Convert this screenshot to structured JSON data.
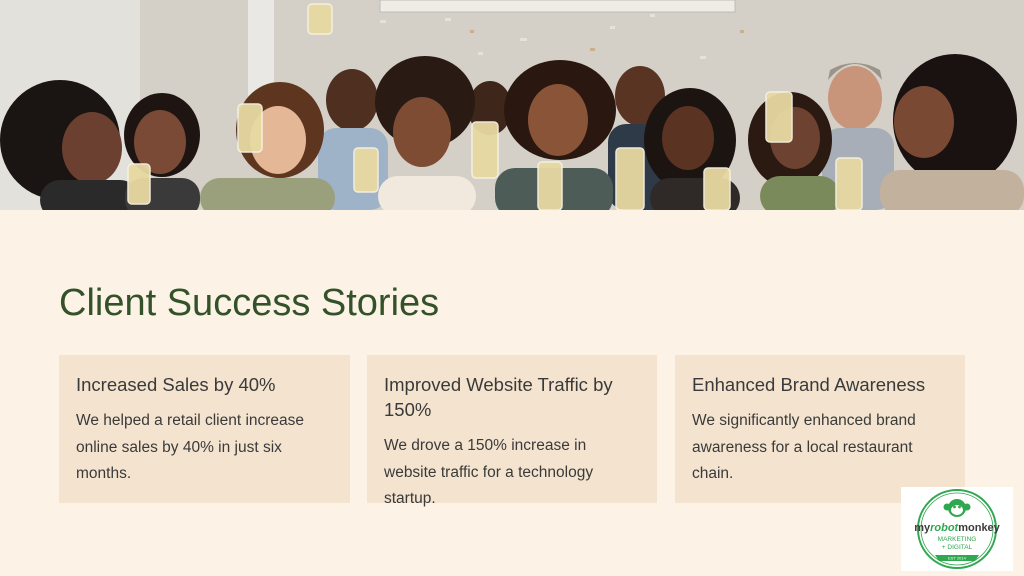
{
  "hero": {
    "image": "celebration-photo"
  },
  "title": "Client Success Stories",
  "cards": [
    {
      "heading": "Increased Sales by 40%",
      "body": "We helped a retail client increase online sales by 40% in just six months."
    },
    {
      "heading": "Improved Website Traffic by 150%",
      "body": "We drove a 150% increase in website traffic for a technology startup."
    },
    {
      "heading": "Enhanced Brand Awareness",
      "body": "We significantly enhanced brand awareness for a local restaurant chain."
    }
  ],
  "logo": {
    "wordmark_pre": "my",
    "wordmark_mid": "robot",
    "wordmark_post": "monkey",
    "line2": "MARKETING",
    "line3": "+ DIGITAL",
    "est": "EST 2014",
    "colors": {
      "green": "#2fa84f",
      "dark": "#3b3b3b"
    }
  },
  "colors": {
    "background": "#fcf3e6",
    "card": "#f4e4cf",
    "title": "#33522a",
    "text": "#3a3a3a"
  }
}
